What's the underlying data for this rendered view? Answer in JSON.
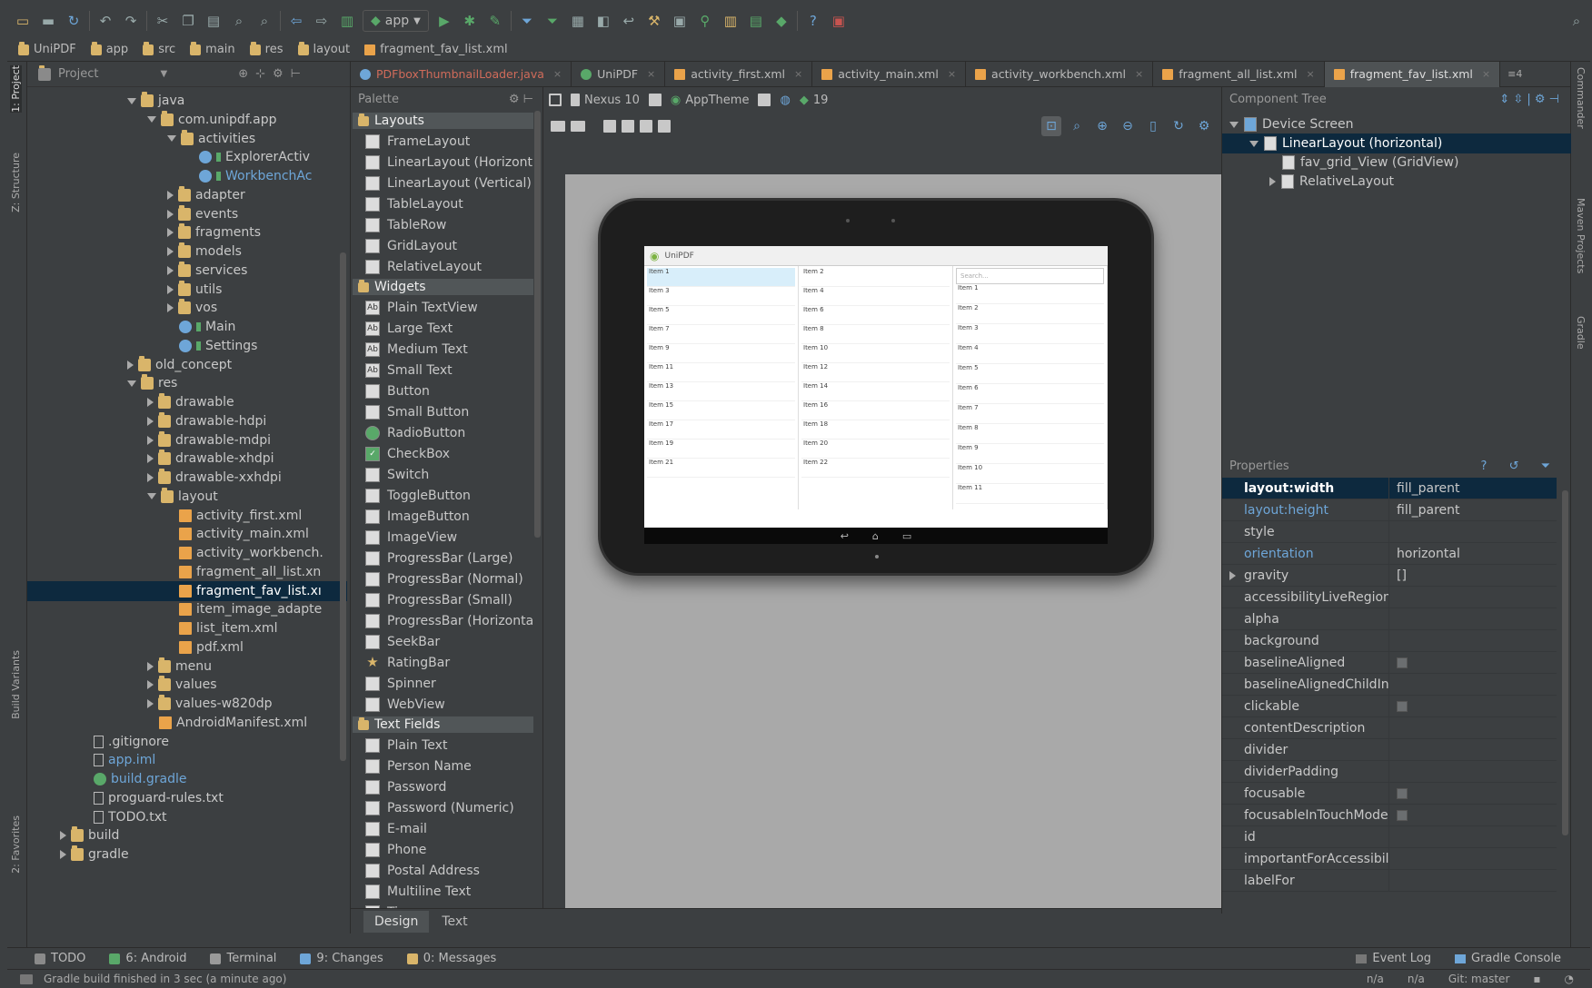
{
  "toolbar": {
    "run_config": "app"
  },
  "breadcrumbs": [
    "UniPDF",
    "app",
    "src",
    "main",
    "res",
    "layout",
    "fragment_fav_list.xml"
  ],
  "project_panel": {
    "title": "Project"
  },
  "left_strip": {
    "project_tab": "1: Project",
    "structure_tab": "Z: Structure",
    "build_variants_tab": "Build Variants",
    "favorites_tab": "2: Favorites"
  },
  "right_strip": {
    "commander_tab": "Commander",
    "maven_tab": "Maven Projects",
    "gradle_tab": "Gradle"
  },
  "tree": [
    {
      "label": "java",
      "depth": 0,
      "kind": "folder",
      "exp": "d"
    },
    {
      "label": "com.unipdf.app",
      "depth": 1,
      "kind": "folder",
      "exp": "d"
    },
    {
      "label": "activities",
      "depth": 2,
      "kind": "folder",
      "exp": "d"
    },
    {
      "label": "ExplorerActiv",
      "depth": 3,
      "kind": "java",
      "exp": ""
    },
    {
      "label": "WorkbenchAc",
      "depth": 3,
      "kind": "java",
      "exp": "",
      "blue": true
    },
    {
      "label": "adapter",
      "depth": 2,
      "kind": "folder",
      "exp": "r"
    },
    {
      "label": "events",
      "depth": 2,
      "kind": "folder",
      "exp": "r"
    },
    {
      "label": "fragments",
      "depth": 2,
      "kind": "folder",
      "exp": "r"
    },
    {
      "label": "models",
      "depth": 2,
      "kind": "folder",
      "exp": "r"
    },
    {
      "label": "services",
      "depth": 2,
      "kind": "folder",
      "exp": "r"
    },
    {
      "label": "utils",
      "depth": 2,
      "kind": "folder",
      "exp": "r"
    },
    {
      "label": "vos",
      "depth": 2,
      "kind": "folder",
      "exp": "r"
    },
    {
      "label": "Main",
      "depth": 2,
      "kind": "java",
      "exp": ""
    },
    {
      "label": "Settings",
      "depth": 2,
      "kind": "java",
      "exp": ""
    },
    {
      "label": "old_concept",
      "depth": 0,
      "kind": "folder",
      "exp": "r"
    },
    {
      "label": "res",
      "depth": 0,
      "kind": "folder",
      "exp": "d"
    },
    {
      "label": "drawable",
      "depth": 1,
      "kind": "folder",
      "exp": "r"
    },
    {
      "label": "drawable-hdpi",
      "depth": 1,
      "kind": "folder",
      "exp": "r"
    },
    {
      "label": "drawable-mdpi",
      "depth": 1,
      "kind": "folder",
      "exp": "r"
    },
    {
      "label": "drawable-xhdpi",
      "depth": 1,
      "kind": "folder",
      "exp": "r"
    },
    {
      "label": "drawable-xxhdpi",
      "depth": 1,
      "kind": "folder",
      "exp": "r"
    },
    {
      "label": "layout",
      "depth": 1,
      "kind": "folder",
      "exp": "d"
    },
    {
      "label": "activity_first.xml",
      "depth": 2,
      "kind": "file",
      "exp": ""
    },
    {
      "label": "activity_main.xml",
      "depth": 2,
      "kind": "file",
      "exp": ""
    },
    {
      "label": "activity_workbench.",
      "depth": 2,
      "kind": "file",
      "exp": ""
    },
    {
      "label": "fragment_all_list.xn",
      "depth": 2,
      "kind": "file",
      "exp": ""
    },
    {
      "label": "fragment_fav_list.xı",
      "depth": 2,
      "kind": "file",
      "exp": "",
      "selected": true
    },
    {
      "label": "item_image_adapte",
      "depth": 2,
      "kind": "file",
      "exp": ""
    },
    {
      "label": "list_item.xml",
      "depth": 2,
      "kind": "file",
      "exp": ""
    },
    {
      "label": "pdf.xml",
      "depth": 2,
      "kind": "file",
      "exp": ""
    },
    {
      "label": "menu",
      "depth": 1,
      "kind": "folder",
      "exp": "r"
    },
    {
      "label": "values",
      "depth": 1,
      "kind": "folder",
      "exp": "r"
    },
    {
      "label": "values-w820dp",
      "depth": 1,
      "kind": "folder",
      "exp": "r"
    },
    {
      "label": "AndroidManifest.xml",
      "depth": 1,
      "kind": "file",
      "exp": ""
    },
    {
      "label": ".gitignore",
      "depth": -1,
      "kind": "doc",
      "exp": ""
    },
    {
      "label": "app.iml",
      "depth": -1,
      "kind": "doc",
      "exp": "",
      "blue": true
    },
    {
      "label": "build.gradle",
      "depth": -1,
      "kind": "gradle",
      "exp": "",
      "blue": true
    },
    {
      "label": "proguard-rules.txt",
      "depth": -1,
      "kind": "doc",
      "exp": ""
    },
    {
      "label": "TODO.txt",
      "depth": -1,
      "kind": "doc",
      "exp": ""
    },
    {
      "label": "build",
      "depth": -2,
      "kind": "folder",
      "exp": "r"
    },
    {
      "label": "gradle",
      "depth": -2,
      "kind": "folder",
      "exp": "r"
    }
  ],
  "editor_tabs": [
    {
      "label": "PDFboxThumbnailLoader.java",
      "active": false,
      "red": true
    },
    {
      "label": "UniPDF",
      "active": false
    },
    {
      "label": "activity_first.xml",
      "active": false
    },
    {
      "label": "activity_main.xml",
      "active": false
    },
    {
      "label": "activity_workbench.xml",
      "active": false
    },
    {
      "label": "fragment_all_list.xml",
      "active": false
    },
    {
      "label": "fragment_fav_list.xml",
      "active": true
    }
  ],
  "tab_overflow": "≡4",
  "palette": {
    "title": "Palette",
    "groups": [
      {
        "name": "Layouts",
        "items": [
          "FrameLayout",
          "LinearLayout (Horizont",
          "LinearLayout (Vertical)",
          "TableLayout",
          "TableRow",
          "GridLayout",
          "RelativeLayout"
        ]
      },
      {
        "name": "Widgets",
        "items": [
          "Plain TextView",
          "Large Text",
          "Medium Text",
          "Small Text",
          "Button",
          "Small Button",
          "RadioButton",
          "CheckBox",
          "Switch",
          "ToggleButton",
          "ImageButton",
          "ImageView",
          "ProgressBar (Large)",
          "ProgressBar (Normal)",
          "ProgressBar (Small)",
          "ProgressBar (Horizonta",
          "SeekBar",
          "RatingBar",
          "Spinner",
          "WebView"
        ]
      },
      {
        "name": "Text Fields",
        "items": [
          "Plain Text",
          "Person Name",
          "Password",
          "Password (Numeric)",
          "E-mail",
          "Phone",
          "Postal Address",
          "Multiline Text",
          "Time"
        ]
      }
    ]
  },
  "design_toolbar": {
    "device": "Nexus 10",
    "theme": "AppTheme",
    "api": "19"
  },
  "device_screen": {
    "app_title": "UniPDF",
    "search_placeholder": "Search...",
    "items": [
      "Item 1",
      "Item 2",
      "Item 3",
      "Item 4",
      "Item 5",
      "Item 6",
      "Item 7",
      "Item 8",
      "Item 9",
      "Item 10",
      "Item 11",
      "Item 12",
      "Item 13",
      "Item 14",
      "Item 15",
      "Item 16",
      "Item 17",
      "Item 18",
      "Item 19",
      "Item 20",
      "Item 21",
      "Item 22"
    ]
  },
  "design_tabs": [
    {
      "label": "Design",
      "active": true
    },
    {
      "label": "Text",
      "active": false
    }
  ],
  "component_tree": {
    "title": "Component Tree",
    "nodes": [
      {
        "label": "Device Screen",
        "depth": 0,
        "exp": "d"
      },
      {
        "label": "LinearLayout (horizontal)",
        "depth": 1,
        "exp": "d",
        "selected": true
      },
      {
        "label": "fav_grid_View (GridView)",
        "depth": 2,
        "exp": ""
      },
      {
        "label": "RelativeLayout",
        "depth": 2,
        "exp": "r"
      }
    ]
  },
  "properties": {
    "title": "Properties",
    "rows": [
      {
        "name": "layout:width",
        "value": "fill_parent",
        "selected": true,
        "bold": true
      },
      {
        "name": "layout:height",
        "value": "fill_parent",
        "blue": true
      },
      {
        "name": "style",
        "value": ""
      },
      {
        "name": "orientation",
        "value": "horizontal",
        "blue": true
      },
      {
        "name": "gravity",
        "value": "[]",
        "expand": true
      },
      {
        "name": "accessibilityLiveRegion",
        "value": ""
      },
      {
        "name": "alpha",
        "value": ""
      },
      {
        "name": "background",
        "value": ""
      },
      {
        "name": "baselineAligned",
        "value": "",
        "check": true
      },
      {
        "name": "baselineAlignedChildIn",
        "value": ""
      },
      {
        "name": "clickable",
        "value": "",
        "check": true
      },
      {
        "name": "contentDescription",
        "value": ""
      },
      {
        "name": "divider",
        "value": ""
      },
      {
        "name": "dividerPadding",
        "value": ""
      },
      {
        "name": "focusable",
        "value": "",
        "check": true
      },
      {
        "name": "focusableInTouchMode",
        "value": "",
        "check": true
      },
      {
        "name": "id",
        "value": ""
      },
      {
        "name": "importantForAccessibil",
        "value": ""
      },
      {
        "name": "labelFor",
        "value": ""
      }
    ]
  },
  "bottom_tools": [
    {
      "label": "TODO",
      "icon": "todo-icon"
    },
    {
      "label": "6: Android",
      "icon": "android-icon"
    },
    {
      "label": "Terminal",
      "icon": "terminal-icon"
    },
    {
      "label": "9: Changes",
      "icon": "changes-icon"
    },
    {
      "label": "0: Messages",
      "icon": "messages-icon"
    }
  ],
  "bottom_right_tools": [
    {
      "label": "Event Log"
    },
    {
      "label": "Gradle Console"
    }
  ],
  "status": {
    "message": "Gradle build finished in 3 sec (a minute ago)",
    "pos1": "n/a",
    "pos2": "n/a",
    "vcs": "Git: master"
  },
  "colors": {
    "accent": "#6ea6d8",
    "selection": "#0d293e",
    "folder": "#d9b56a",
    "run": "#59a869"
  }
}
